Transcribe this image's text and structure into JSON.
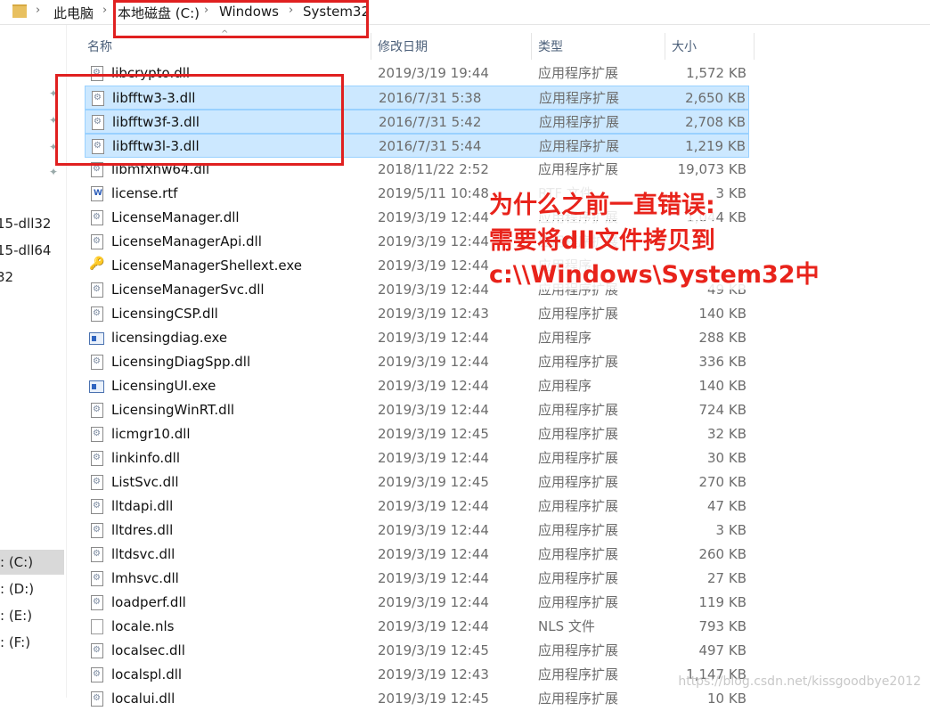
{
  "breadcrumb": {
    "items": [
      "此电脑",
      "本地磁盘 (C:)",
      "Windows",
      "System32"
    ]
  },
  "sidebar": {
    "partial_items": [
      "15-dll32",
      "15-dll64",
      "32"
    ],
    "drives": [
      {
        "label": ": (C:)",
        "selected": true
      },
      {
        "label": ": (D:)",
        "selected": false
      },
      {
        "label": ": (E:)",
        "selected": false
      },
      {
        "label": ": (F:)",
        "selected": false
      }
    ]
  },
  "columns": {
    "name": "名称",
    "date": "修改日期",
    "type": "类型",
    "size": "大小"
  },
  "files": [
    {
      "name": "libcrypto.dll",
      "date": "2019/3/19 19:44",
      "type": "应用程序扩展",
      "size": "1,572 KB",
      "icon": "dll-file-icon",
      "selected": false
    },
    {
      "name": "libfftw3-3.dll",
      "date": "2016/7/31 5:38",
      "type": "应用程序扩展",
      "size": "2,650 KB",
      "icon": "dll-file-icon",
      "selected": true
    },
    {
      "name": "libfftw3f-3.dll",
      "date": "2016/7/31 5:42",
      "type": "应用程序扩展",
      "size": "2,708 KB",
      "icon": "dll-file-icon",
      "selected": true
    },
    {
      "name": "libfftw3l-3.dll",
      "date": "2016/7/31 5:44",
      "type": "应用程序扩展",
      "size": "1,219 KB",
      "icon": "dll-file-icon",
      "selected": true
    },
    {
      "name": "libmfxhw64.dll",
      "date": "2018/11/22 2:52",
      "type": "应用程序扩展",
      "size": "19,073 KB",
      "icon": "dll-file-icon",
      "selected": false
    },
    {
      "name": "license.rtf",
      "date": "2019/5/11 10:48",
      "type": "RTF 文件",
      "size": "3 KB",
      "icon": "rtf-file-icon",
      "selected": false
    },
    {
      "name": "LicenseManager.dll",
      "date": "2019/3/19 12:44",
      "type": "应用程序扩展",
      "size": "1,044 KB",
      "icon": "dll-file-icon",
      "selected": false
    },
    {
      "name": "LicenseManagerApi.dll",
      "date": "2019/3/19 12:44",
      "type": "应用程序扩展",
      "size": "",
      "icon": "dll-file-icon",
      "selected": false
    },
    {
      "name": "LicenseManagerShellext.exe",
      "date": "2019/3/19 12:44",
      "type": "应用程序",
      "size": "",
      "icon": "key-exe-icon",
      "selected": false
    },
    {
      "name": "LicenseManagerSvc.dll",
      "date": "2019/3/19 12:44",
      "type": "应用程序扩展",
      "size": "49 KB",
      "icon": "dll-file-icon",
      "selected": false
    },
    {
      "name": "LicensingCSP.dll",
      "date": "2019/3/19 12:43",
      "type": "应用程序扩展",
      "size": "140 KB",
      "icon": "dll-file-icon",
      "selected": false
    },
    {
      "name": "licensingdiag.exe",
      "date": "2019/3/19 12:44",
      "type": "应用程序",
      "size": "288 KB",
      "icon": "exe-file-icon",
      "selected": false
    },
    {
      "name": "LicensingDiagSpp.dll",
      "date": "2019/3/19 12:44",
      "type": "应用程序扩展",
      "size": "336 KB",
      "icon": "dll-file-icon",
      "selected": false
    },
    {
      "name": "LicensingUI.exe",
      "date": "2019/3/19 12:44",
      "type": "应用程序",
      "size": "140 KB",
      "icon": "exe-file-icon",
      "selected": false
    },
    {
      "name": "LicensingWinRT.dll",
      "date": "2019/3/19 12:44",
      "type": "应用程序扩展",
      "size": "724 KB",
      "icon": "dll-file-icon",
      "selected": false
    },
    {
      "name": "licmgr10.dll",
      "date": "2019/3/19 12:45",
      "type": "应用程序扩展",
      "size": "32 KB",
      "icon": "dll-file-icon",
      "selected": false
    },
    {
      "name": "linkinfo.dll",
      "date": "2019/3/19 12:44",
      "type": "应用程序扩展",
      "size": "30 KB",
      "icon": "dll-file-icon",
      "selected": false
    },
    {
      "name": "ListSvc.dll",
      "date": "2019/3/19 12:45",
      "type": "应用程序扩展",
      "size": "270 KB",
      "icon": "dll-file-icon",
      "selected": false
    },
    {
      "name": "lltdapi.dll",
      "date": "2019/3/19 12:44",
      "type": "应用程序扩展",
      "size": "47 KB",
      "icon": "dll-file-icon",
      "selected": false
    },
    {
      "name": "lltdres.dll",
      "date": "2019/3/19 12:44",
      "type": "应用程序扩展",
      "size": "3 KB",
      "icon": "dll-file-icon",
      "selected": false
    },
    {
      "name": "lltdsvc.dll",
      "date": "2019/3/19 12:44",
      "type": "应用程序扩展",
      "size": "260 KB",
      "icon": "dll-file-icon",
      "selected": false
    },
    {
      "name": "lmhsvc.dll",
      "date": "2019/3/19 12:44",
      "type": "应用程序扩展",
      "size": "27 KB",
      "icon": "dll-file-icon",
      "selected": false
    },
    {
      "name": "loadperf.dll",
      "date": "2019/3/19 12:44",
      "type": "应用程序扩展",
      "size": "119 KB",
      "icon": "dll-file-icon",
      "selected": false
    },
    {
      "name": "locale.nls",
      "date": "2019/3/19 12:44",
      "type": "NLS 文件",
      "size": "793 KB",
      "icon": "nls-file-icon",
      "selected": false
    },
    {
      "name": "localsec.dll",
      "date": "2019/3/19 12:45",
      "type": "应用程序扩展",
      "size": "497 KB",
      "icon": "dll-file-icon",
      "selected": false
    },
    {
      "name": "localspl.dll",
      "date": "2019/3/19 12:43",
      "type": "应用程序扩展",
      "size": "1,147 KB",
      "icon": "dll-file-icon",
      "selected": false
    },
    {
      "name": "localui.dll",
      "date": "2019/3/19 12:45",
      "type": "应用程序扩展",
      "size": "10 KB",
      "icon": "dll-file-icon",
      "selected": false
    }
  ],
  "annotation": {
    "line1": "为什么之前一直错误:",
    "line2": "需要将dll文件拷贝到",
    "line3": "c:\\\\Windows\\System32中"
  },
  "watermark": "https://blog.csdn.net/kissgoodbye2012",
  "colors": {
    "selection_bg": "#cce8ff",
    "selection_border": "#99d1ff",
    "annotation_red": "#e8231b",
    "highlight_box": "#e02020"
  }
}
